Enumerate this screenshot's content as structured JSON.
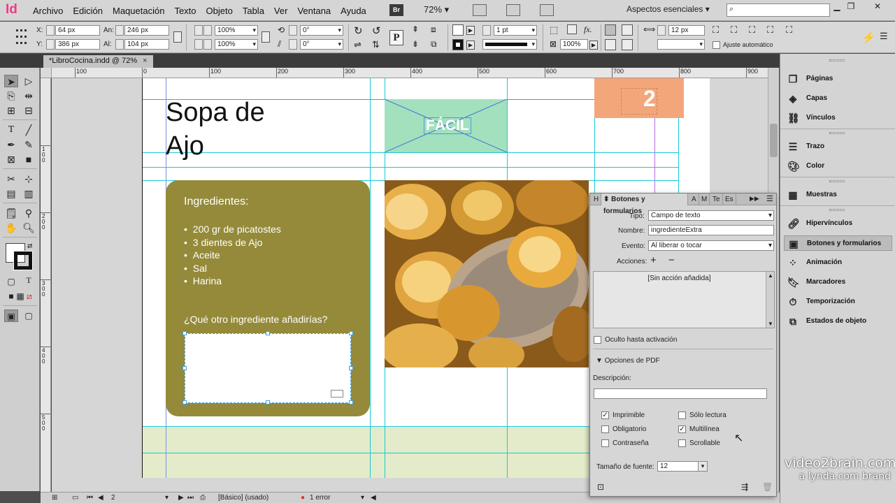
{
  "app": {
    "logo": "Id"
  },
  "menu": [
    "Archivo",
    "Edición",
    "Maquetación",
    "Texto",
    "Objeto",
    "Tabla",
    "Ver",
    "Ventana",
    "Ayuda"
  ],
  "menubar": {
    "bridge": "Br",
    "zoom": "72%",
    "workspace": "Aspectos esenciales",
    "search_placeholder": ""
  },
  "control": {
    "x_label": "X:",
    "x": "64 px",
    "y_label": "Y:",
    "y": "386 px",
    "w_label": "An:",
    "w": "246 px",
    "h_label": "Al:",
    "h": "104 px",
    "scale_x": "100%",
    "scale_y": "100%",
    "rotate": "0°",
    "shear": "0°",
    "stroke_weight": "1 pt",
    "opacity": "100%",
    "spacing": "12 px",
    "autofit": "Ajuste automático"
  },
  "document_tab": {
    "title": "*LibroCocina.indd @ 72%",
    "close": "×"
  },
  "ruler": {
    "h": [
      "100",
      "0",
      "100",
      "200",
      "300",
      "400",
      "500",
      "600",
      "700",
      "800",
      "900"
    ],
    "v": [
      "100",
      "200",
      "300",
      "400",
      "500"
    ]
  },
  "page": {
    "title_line1": "Sopa de",
    "title_line2": "Ajo",
    "badge": "FÁCIL",
    "number": "2",
    "ingredients_title": "Ingredientes:",
    "ingredients": [
      "200 gr de picatostes",
      "3 dientes de Ajo",
      "Aceite",
      "Sal",
      "Harina"
    ],
    "question": "¿Qué otro ingrediente añadirías?"
  },
  "statusbar": {
    "page": "2",
    "master": "[Básico] (usado)",
    "errors": "1 error"
  },
  "dock": {
    "items": [
      {
        "label": "Páginas",
        "icon": "pages-icon"
      },
      {
        "label": "Capas",
        "icon": "layers-icon"
      },
      {
        "label": "Vínculos",
        "icon": "links-icon"
      },
      {
        "label": "Trazo",
        "icon": "stroke-icon"
      },
      {
        "label": "Color",
        "icon": "color-icon"
      },
      {
        "label": "Muestras",
        "icon": "swatches-icon"
      },
      {
        "label": "Hipervínculos",
        "icon": "hyperlinks-icon"
      },
      {
        "label": "Botones y formularios",
        "icon": "buttons-forms-icon"
      },
      {
        "label": "Animación",
        "icon": "animation-icon"
      },
      {
        "label": "Marcadores",
        "icon": "bookmarks-icon"
      },
      {
        "label": "Temporización",
        "icon": "timing-icon"
      },
      {
        "label": "Estados de objeto",
        "icon": "object-states-icon"
      }
    ]
  },
  "panel": {
    "tabs": [
      "H",
      "Botones y formularios",
      "A",
      "M",
      "Te",
      "Es"
    ],
    "tipo_label": "Tipo:",
    "tipo": "Campo de texto",
    "nombre_label": "Nombre:",
    "nombre": "ingredienteExtra",
    "evento_label": "Evento:",
    "evento": "Al liberar o tocar",
    "acciones_label": "Acciones:",
    "no_action": "[Sin acción añadida]",
    "hidden": "Oculto hasta activación",
    "pdf_options": "Opciones de PDF",
    "description_label": "Descripción:",
    "description": "",
    "checks": [
      {
        "label": "Imprimible",
        "checked": true
      },
      {
        "label": "Sólo lectura",
        "checked": false
      },
      {
        "label": "Obligatorio",
        "checked": false
      },
      {
        "label": "Multilínea",
        "checked": true
      },
      {
        "label": "Contraseña",
        "checked": false
      },
      {
        "label": "Scrollable",
        "checked": false
      }
    ],
    "font_size_label": "Tamaño de fuente:",
    "font_size": "12"
  },
  "watermark": {
    "line1": "video2brain.com",
    "line2": "a lynda.com brand"
  },
  "colors": {
    "olive_box": "#948a3a",
    "badge_green": "#a3e0bd",
    "number_orange": "#f3a67a",
    "guide_cyan": "#19c9d6"
  }
}
